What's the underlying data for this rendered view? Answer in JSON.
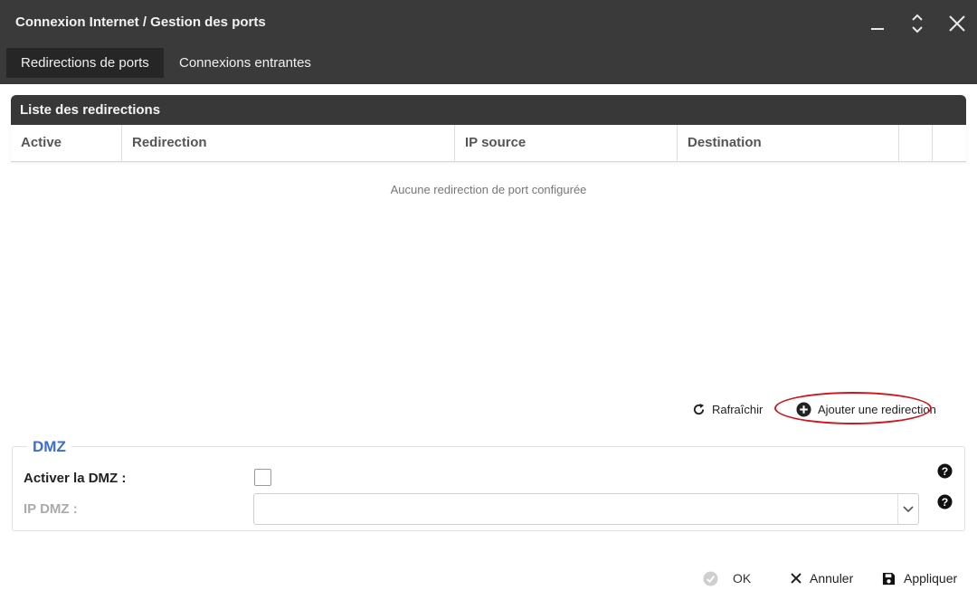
{
  "window": {
    "title": "Connexion Internet / Gestion des ports",
    "controls": [
      "minimize-icon",
      "maximize-icon",
      "close-icon"
    ]
  },
  "tabs": [
    {
      "label": "Redirections de ports",
      "active": true
    },
    {
      "label": "Connexions entrantes",
      "active": false
    }
  ],
  "list": {
    "title": "Liste des redirections",
    "columns": [
      "Active",
      "Redirection",
      "IP source",
      "Destination"
    ],
    "empty_message": "Aucune redirection de port configurée",
    "refresh_label": "Rafraîchir",
    "add_label": "Ajouter une redirection"
  },
  "dmz": {
    "legend": "DMZ",
    "enable_label": "Activer la DMZ :",
    "enable_checked": false,
    "ip_label": "IP DMZ :",
    "ip_value": ""
  },
  "footer": {
    "ok_label": "OK",
    "cancel_label": "Annuler",
    "apply_label": "Appliquer"
  },
  "colors": {
    "titlebar": "#3a3a3a",
    "accent": "#3b6fd4",
    "highlight": "#d0161b"
  }
}
